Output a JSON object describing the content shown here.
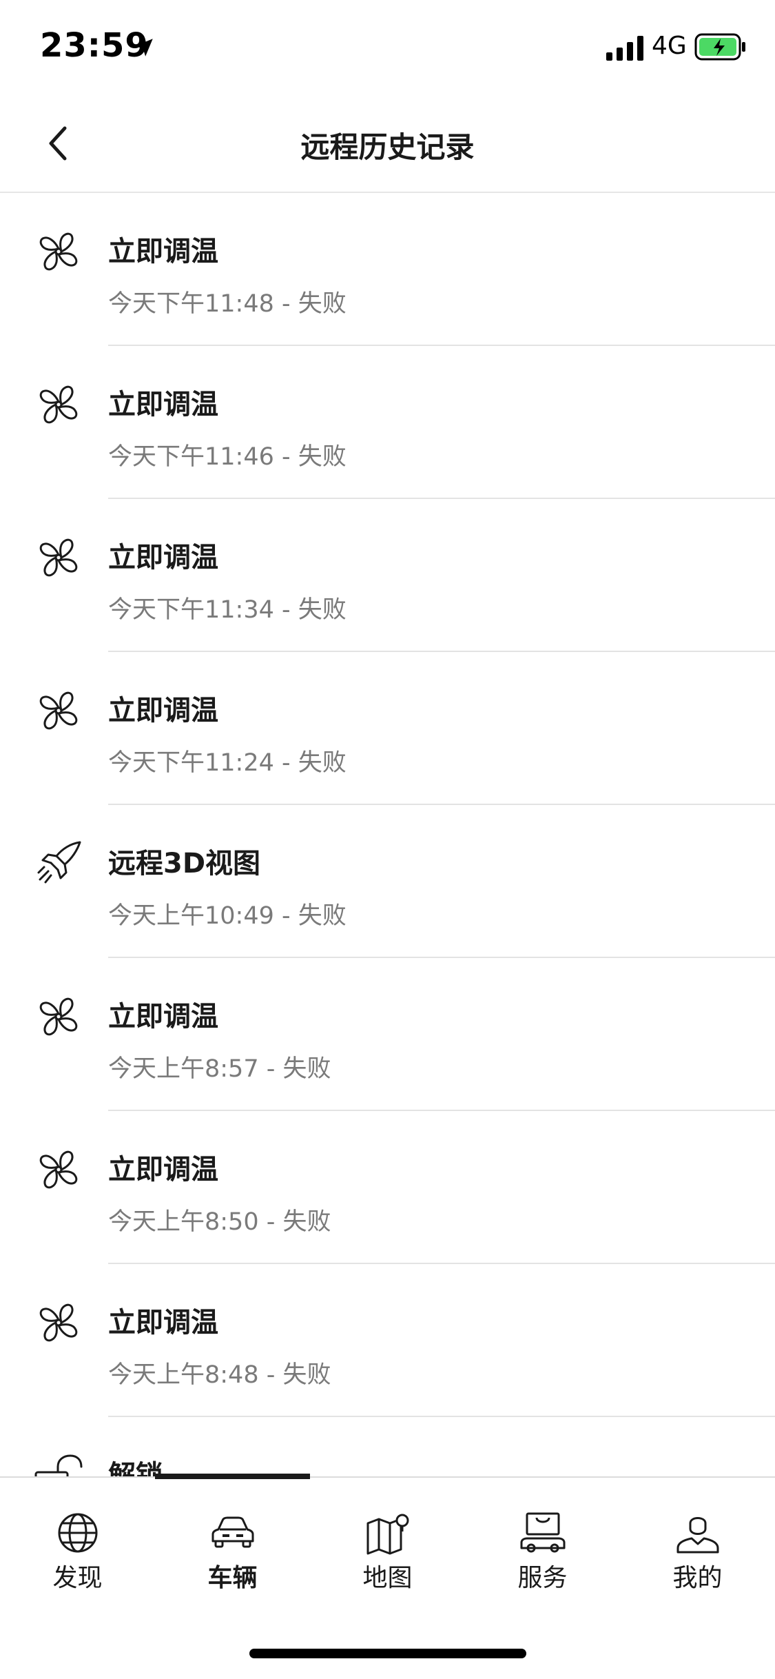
{
  "status_bar": {
    "time": "23:59",
    "network": "4G",
    "battery_color": "#4cd964"
  },
  "header": {
    "title": "远程历史记录",
    "back_icon": "chevron-left-icon"
  },
  "history": {
    "items": [
      {
        "icon": "fan-icon",
        "title": "立即调温",
        "subtitle": "今天下午11:48 - 失败"
      },
      {
        "icon": "fan-icon",
        "title": "立即调温",
        "subtitle": "今天下午11:46 - 失败"
      },
      {
        "icon": "fan-icon",
        "title": "立即调温",
        "subtitle": "今天下午11:34 - 失败"
      },
      {
        "icon": "fan-icon",
        "title": "立即调温",
        "subtitle": "今天下午11:24 - 失败"
      },
      {
        "icon": "satellite-icon",
        "title": "远程3D视图",
        "subtitle": "今天上午10:49 - 失败"
      },
      {
        "icon": "fan-icon",
        "title": "立即调温",
        "subtitle": "今天上午8:57 - 失败"
      },
      {
        "icon": "fan-icon",
        "title": "立即调温",
        "subtitle": "今天上午8:50 - 失败"
      },
      {
        "icon": "fan-icon",
        "title": "立即调温",
        "subtitle": "今天上午8:48 - 失败"
      },
      {
        "icon": "unlock-icon",
        "title": "解锁",
        "subtitle": ""
      }
    ]
  },
  "tab_bar": {
    "active_index": 1,
    "tabs": [
      {
        "icon": "globe-icon",
        "label": "发现"
      },
      {
        "icon": "car-icon",
        "label": "车辆"
      },
      {
        "icon": "map-icon",
        "label": "地图"
      },
      {
        "icon": "shopping-bag-icon",
        "label": "服务"
      },
      {
        "icon": "person-icon",
        "label": "我的"
      }
    ]
  }
}
